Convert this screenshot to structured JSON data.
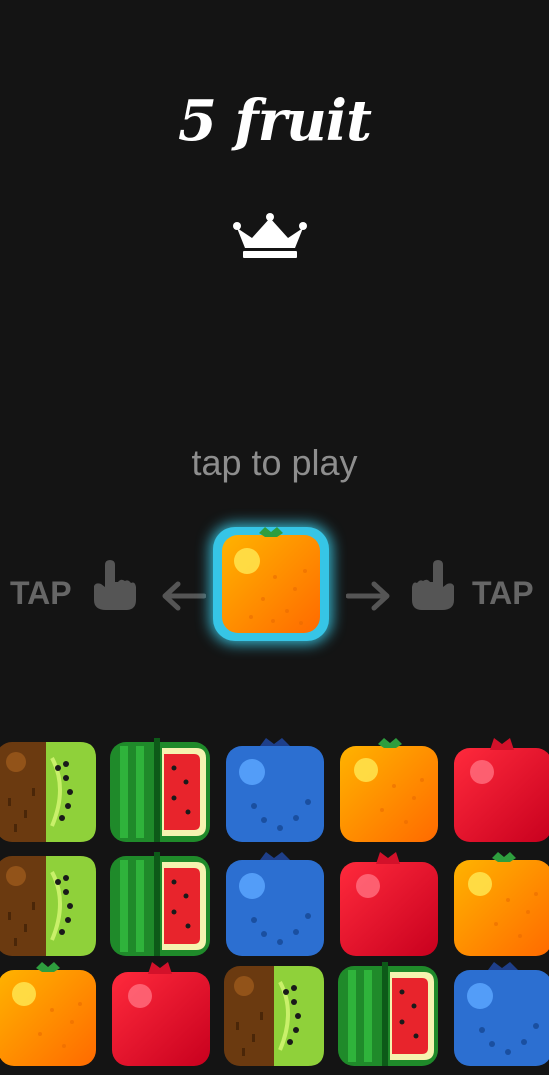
{
  "title": "5 fruit",
  "icons": {
    "crown": "crown-icon",
    "left_hand": "hand-pointing-icon",
    "right_hand": "hand-pointing-icon",
    "left_arrow": "arrow-left-icon",
    "right_arrow": "arrow-right-icon"
  },
  "prompt": "tap to play",
  "controls": {
    "left_label": "TAP",
    "right_label": "TAP"
  },
  "player_fruit": "orange",
  "grid": {
    "rows": [
      [
        "kiwi",
        "watermelon",
        "blueberry",
        "orange",
        "pomegranate"
      ],
      [
        "kiwi",
        "watermelon",
        "blueberry",
        "pomegranate",
        "orange"
      ],
      [
        "orange",
        "pomegranate",
        "kiwi",
        "watermelon",
        "blueberry"
      ]
    ]
  },
  "colors": {
    "background": "#141414",
    "title": "#ffffff",
    "prompt": "#8e8e8e",
    "controls": "#666666",
    "highlight": "#36c5e6"
  }
}
